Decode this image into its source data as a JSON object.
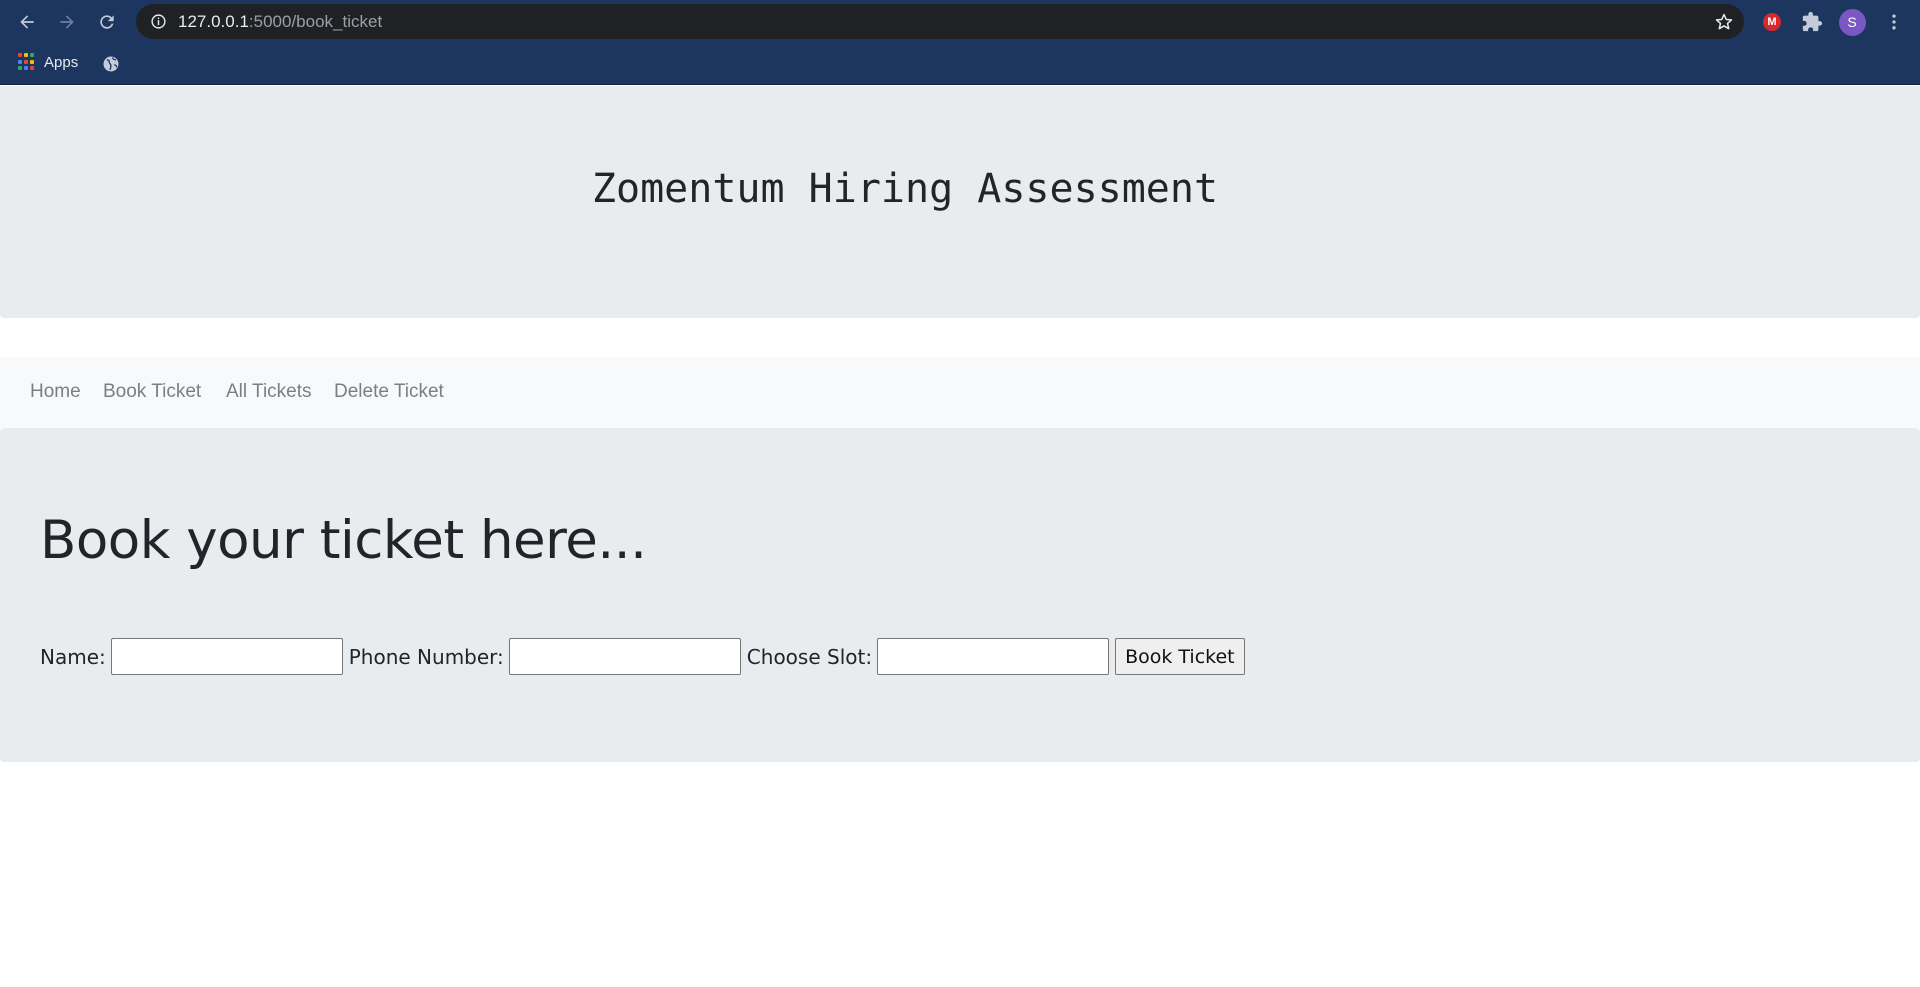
{
  "browser": {
    "url_host": "127.0.0.1",
    "url_rest": ":5000/book_ticket",
    "bookmarks": {
      "apps_label": "Apps"
    },
    "extension_mega_label": "M",
    "profile_initial": "S"
  },
  "header": {
    "title": "Zomentum Hiring Assessment"
  },
  "nav": {
    "items": [
      {
        "label": "Home"
      },
      {
        "label": "Book Ticket"
      },
      {
        "label": "All Tickets"
      },
      {
        "label": "Delete Ticket"
      }
    ]
  },
  "main": {
    "heading": "Book your ticket here...",
    "form": {
      "name_label": "Name:",
      "name_value": "",
      "phone_label": "Phone Number:",
      "phone_value": "",
      "slot_label": "Choose Slot:",
      "slot_value": "",
      "submit_label": "Book Ticket"
    }
  },
  "colors": {
    "chrome_bg": "#1c3660",
    "omnibox_bg": "#202124",
    "jumbotron_bg": "#e9ecef",
    "navbar_bg": "#f8f9fa",
    "nav_link": "#7a7f85"
  }
}
